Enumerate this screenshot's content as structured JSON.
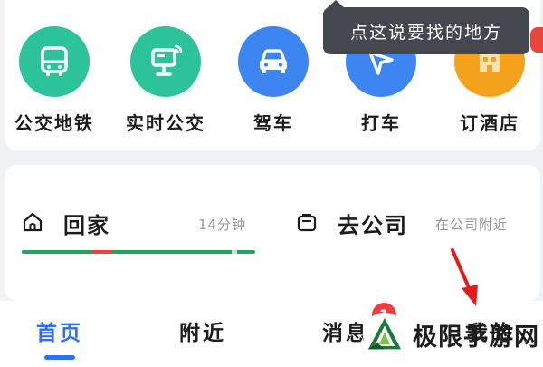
{
  "tooltip": {
    "text": "点这说要找的地方"
  },
  "shortcuts": [
    {
      "label": "公交地铁",
      "icon": "bus-icon",
      "color": "#2cc39a"
    },
    {
      "label": "实时公交",
      "icon": "bus-stop-sign-icon",
      "color": "#2cc39a"
    },
    {
      "label": "驾车",
      "icon": "car-icon",
      "color": "#3d86f2"
    },
    {
      "label": "打车",
      "icon": "taxi-arrow-icon",
      "color": "#3d86f2"
    },
    {
      "label": "订酒店",
      "icon": "hotel-icon",
      "color": "#f4a21c"
    }
  ],
  "destinations": {
    "home": {
      "title": "回家",
      "subtitle": "14分钟",
      "icon": "home-icon"
    },
    "work": {
      "title": "去公司",
      "subtitle": "在公司附近",
      "icon": "briefcase-icon"
    }
  },
  "nav": {
    "items": [
      {
        "label": "首页",
        "active": true
      },
      {
        "label": "附近",
        "active": false
      },
      {
        "label": "消息",
        "active": false
      },
      {
        "label": "我的",
        "active": false
      }
    ],
    "message_badge": "1"
  },
  "watermark": {
    "text": "极限手游网",
    "icon": "watermark-logo-icon"
  },
  "colors": {
    "accent": "#2f6ef4",
    "route_green": "#22a55a",
    "route_red": "#e8453c",
    "tooltip_bg": "#44474e"
  }
}
